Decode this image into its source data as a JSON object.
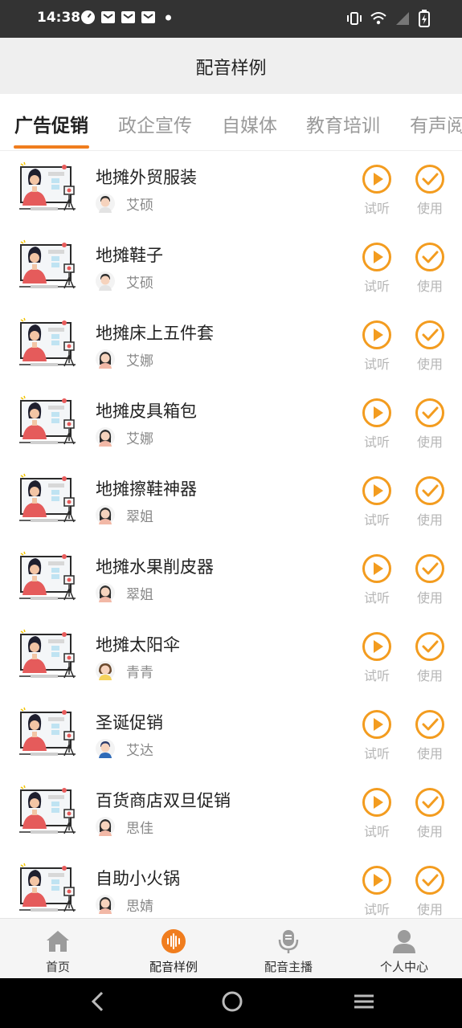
{
  "status_bar": {
    "time": "14:38"
  },
  "header": {
    "title": "配音样例"
  },
  "tabs": [
    {
      "label": "广告促销",
      "active": true
    },
    {
      "label": "政企宣传",
      "active": false
    },
    {
      "label": "自媒体",
      "active": false
    },
    {
      "label": "教育培训",
      "active": false
    },
    {
      "label": "有声阅",
      "active": false
    }
  ],
  "accent_color": "#f39c1f",
  "items": [
    {
      "title": "地摊外贸服装",
      "voice": "艾硕",
      "avatar": "male-avatar-icon"
    },
    {
      "title": "地摊鞋子",
      "voice": "艾硕",
      "avatar": "male-avatar-icon"
    },
    {
      "title": "地摊床上五件套",
      "voice": "艾娜",
      "avatar": "female-avatar-icon"
    },
    {
      "title": "地摊皮具箱包",
      "voice": "艾娜",
      "avatar": "female-avatar-icon"
    },
    {
      "title": "地摊擦鞋神器",
      "voice": "翠姐",
      "avatar": "female-avatar-icon"
    },
    {
      "title": "地摊水果削皮器",
      "voice": "翠姐",
      "avatar": "female-avatar-icon"
    },
    {
      "title": "地摊太阳伞",
      "voice": "青青",
      "avatar": "girl-avatar-icon"
    },
    {
      "title": "圣诞促销",
      "voice": "艾达",
      "avatar": "boy-avatar-icon"
    },
    {
      "title": "百货商店双旦促销",
      "voice": "思佳",
      "avatar": "female-avatar-icon"
    },
    {
      "title": "自助小火锅",
      "voice": "思婧",
      "avatar": "female-avatar-icon"
    }
  ],
  "actions": {
    "play_label": "试听",
    "use_label": "使用"
  },
  "bottom_nav": [
    {
      "label": "首页",
      "active": false
    },
    {
      "label": "配音样例",
      "active": true
    },
    {
      "label": "配音主播",
      "active": false
    },
    {
      "label": "个人中心",
      "active": false
    }
  ]
}
